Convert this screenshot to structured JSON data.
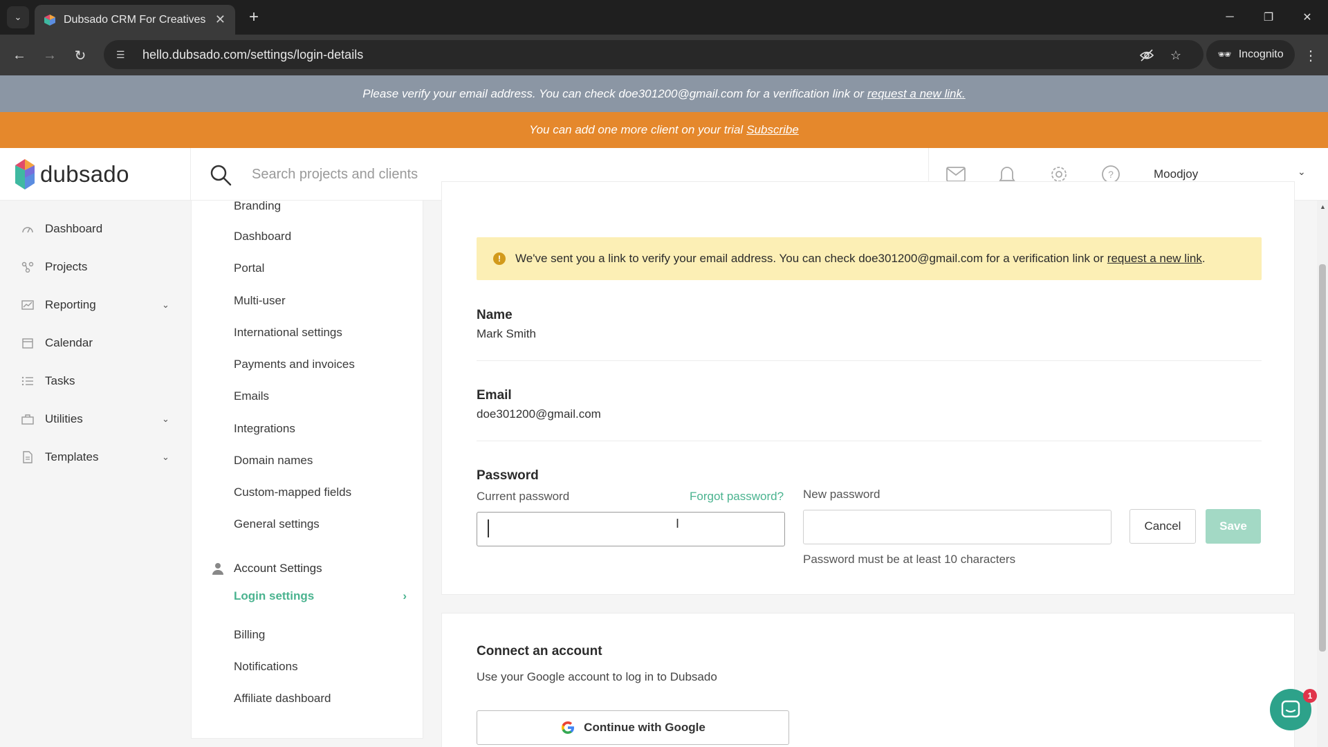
{
  "browser": {
    "tab_title": "Dubsado CRM For Creatives",
    "url": "hello.dubsado.com/settings/login-details",
    "incognito_label": "Incognito"
  },
  "banners": {
    "verify_text": "Please verify your email address. You can check doe301200@gmail.com for a verification link or",
    "verify_link": "request a new link.",
    "trial_text": "You can add one more client on your trial",
    "trial_link": "Subscribe"
  },
  "header": {
    "logo_text": "dubsado",
    "search_placeholder": "Search projects and clients",
    "user_name": "Moodjoy"
  },
  "sidebar": {
    "items": [
      {
        "label": "Dashboard",
        "icon": "dashboard-icon"
      },
      {
        "label": "Projects",
        "icon": "projects-icon"
      },
      {
        "label": "Reporting",
        "icon": "reporting-icon",
        "expandable": true
      },
      {
        "label": "Calendar",
        "icon": "calendar-icon"
      },
      {
        "label": "Tasks",
        "icon": "tasks-icon"
      },
      {
        "label": "Utilities",
        "icon": "utilities-icon",
        "expandable": true
      },
      {
        "label": "Templates",
        "icon": "templates-icon",
        "expandable": true
      }
    ]
  },
  "settings_nav": {
    "items": [
      "Branding",
      "Dashboard",
      "Portal",
      "Multi-user",
      "International settings",
      "Payments and invoices",
      "Emails",
      "Integrations",
      "Domain names",
      "Custom-mapped fields",
      "General settings"
    ],
    "account_section": "Account Settings",
    "active_item": "Login settings",
    "account_items": [
      "Billing",
      "Notifications",
      "Affiliate dashboard"
    ]
  },
  "login": {
    "alert_text": "We've sent you a link to verify your email address. You can check doe301200@gmail.com for a verification link or",
    "alert_link": "request a new link",
    "name_label": "Name",
    "name_value": "Mark Smith",
    "email_label": "Email",
    "email_value": "doe301200@gmail.com",
    "password_label": "Password",
    "current_password_label": "Current password",
    "forgot_password": "Forgot password?",
    "new_password_label": "New password",
    "password_hint": "Password must be at least 10 characters",
    "cancel": "Cancel",
    "save": "Save"
  },
  "connect": {
    "title": "Connect an account",
    "description": "Use your Google account to log in to Dubsado",
    "google_button": "Continue with Google"
  },
  "chat": {
    "badge_count": "1"
  },
  "colors": {
    "accent_green": "#4ab38f",
    "trial_orange": "#e5882c",
    "verify_gray": "#8b96a4",
    "alert_yellow": "#fcefb5"
  }
}
